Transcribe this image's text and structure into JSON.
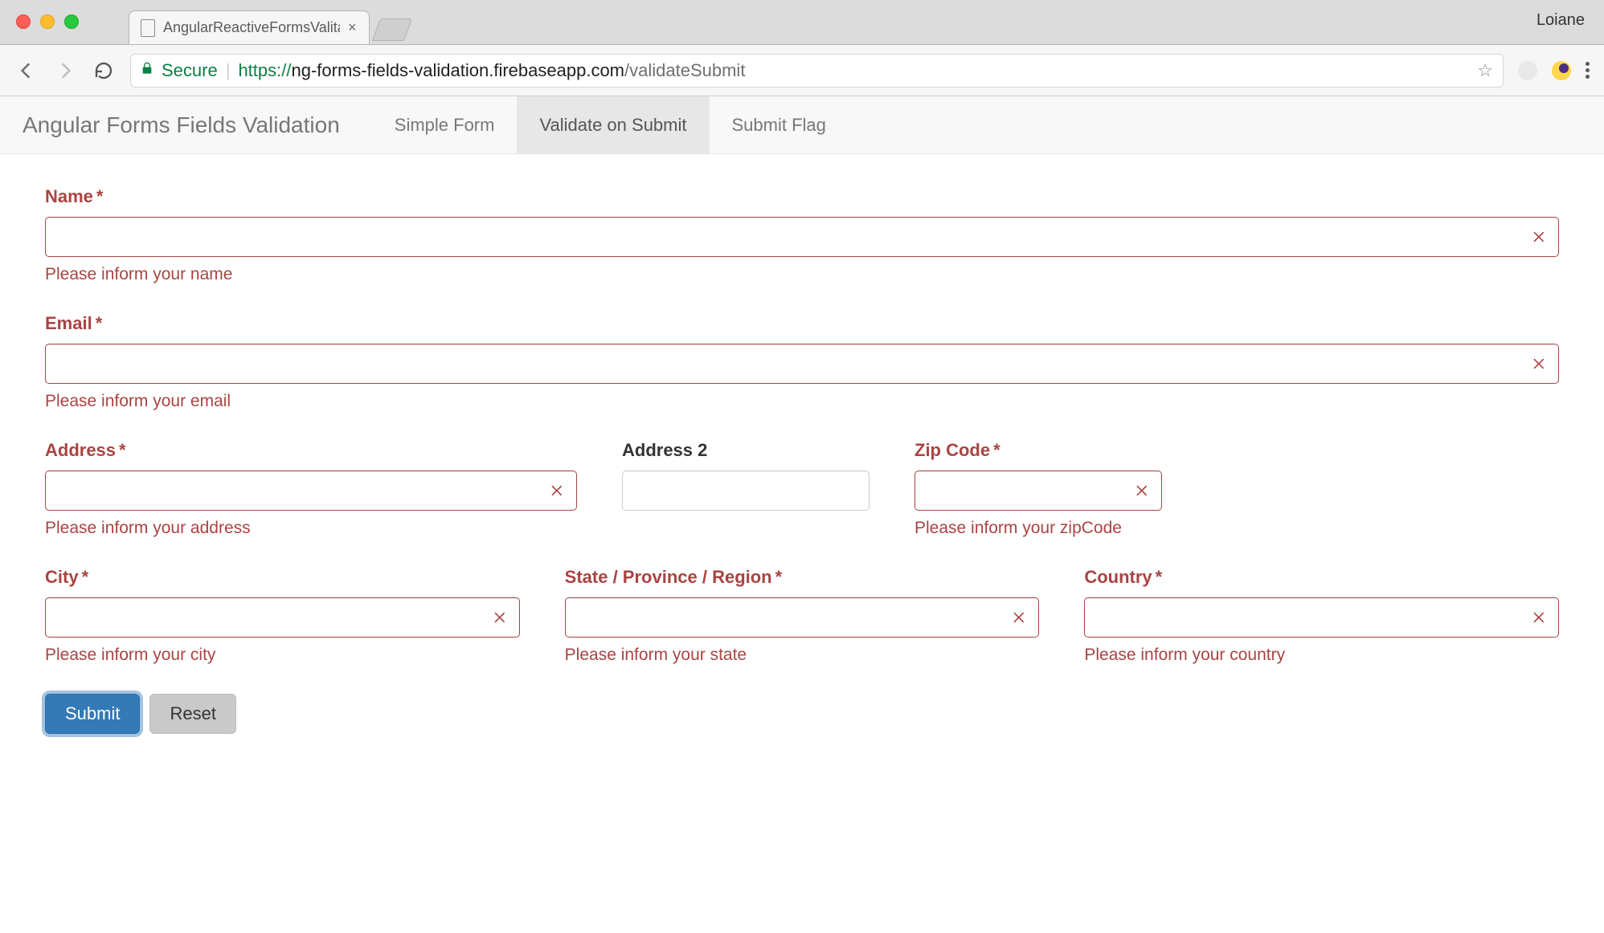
{
  "browser": {
    "tab_title": "AngularReactiveFormsValitate",
    "profile": "Loiane",
    "secure_label": "Secure",
    "url_protocol": "https://",
    "url_host": "ng-forms-fields-validation.firebaseapp.com",
    "url_path": "/validateSubmit"
  },
  "navbar": {
    "brand": "Angular Forms Fields Validation",
    "items": [
      {
        "label": "Simple Form",
        "active": false
      },
      {
        "label": "Validate on Submit",
        "active": true
      },
      {
        "label": "Submit Flag",
        "active": false
      }
    ]
  },
  "form": {
    "fields": {
      "name": {
        "label": "Name",
        "required": true,
        "value": "",
        "error": "Please inform your name",
        "has_error": true
      },
      "email": {
        "label": "Email",
        "required": true,
        "value": "",
        "error": "Please inform your email",
        "has_error": true
      },
      "address": {
        "label": "Address",
        "required": true,
        "value": "",
        "error": "Please inform your address",
        "has_error": true
      },
      "address2": {
        "label": "Address 2",
        "required": false,
        "value": "",
        "error": "",
        "has_error": false
      },
      "zip": {
        "label": "Zip Code",
        "required": true,
        "value": "",
        "error": "Please inform your zipCode",
        "has_error": true
      },
      "city": {
        "label": "City",
        "required": true,
        "value": "",
        "error": "Please inform your city",
        "has_error": true
      },
      "state": {
        "label": "State / Province / Region",
        "required": true,
        "value": "",
        "error": "Please inform your state",
        "has_error": true
      },
      "country": {
        "label": "Country",
        "required": true,
        "value": "",
        "error": "Please inform your country",
        "has_error": true
      }
    },
    "buttons": {
      "submit": "Submit",
      "reset": "Reset"
    }
  },
  "colors": {
    "error": "#a94442",
    "primary": "#337ab7",
    "secure": "#0b8043"
  }
}
